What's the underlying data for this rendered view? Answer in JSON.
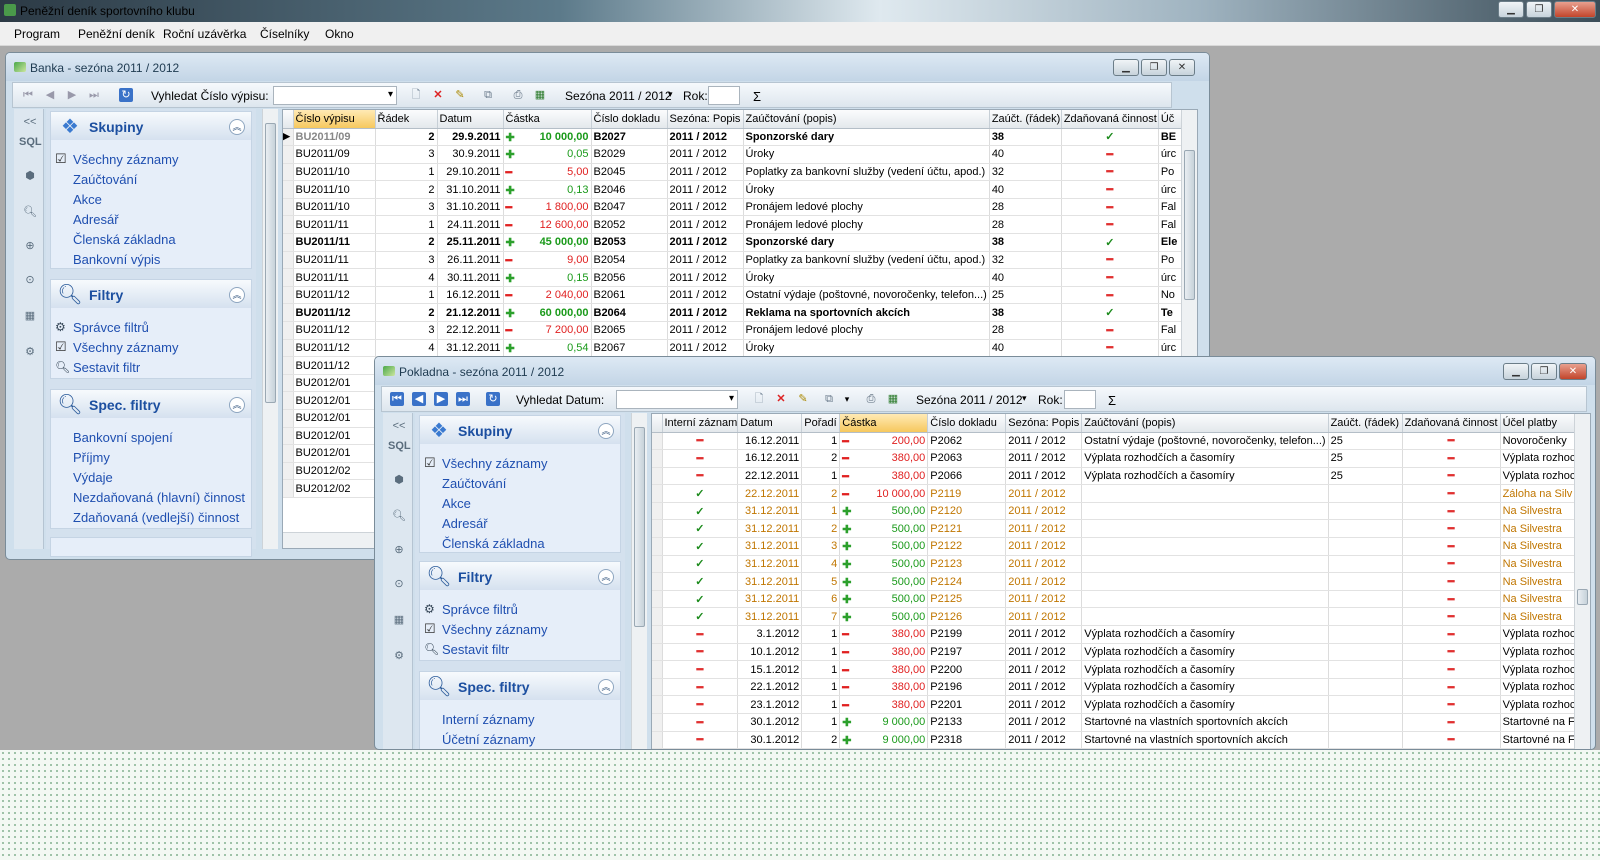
{
  "app": {
    "title": "Peněžní deník sportovního klubu",
    "menu": [
      "Program",
      "Peněžní deník",
      "Roční uzávěrka",
      "Číselníky",
      "Okno"
    ]
  },
  "banka": {
    "title": "Banka - sezóna 2011 / 2012",
    "toolbar": {
      "search_label": "Vyhledat Číslo výpisu:",
      "season": "Sezóna 2011 / 2012",
      "year_label": "Rok:",
      "sum": "Σ"
    },
    "strip": {
      "collapse": "<<",
      "sql": "SQL"
    },
    "groups": {
      "skupiny": {
        "title": "Skupiny",
        "items": [
          "Všechny záznamy",
          "Zaúčtování",
          "Akce",
          "Adresář",
          "Členská základna",
          "Bankovní výpis"
        ]
      },
      "filtry": {
        "title": "Filtry",
        "items": [
          "Správce filtrů",
          "Všechny záznamy",
          "Sestavit filtr"
        ]
      },
      "spec": {
        "title": "Spec. filtry",
        "items": [
          "Bankovní spojení",
          "Příjmy",
          "Výdaje",
          "Nezdaňovaná (hlavní) činnost",
          "Zdaňovaná (vedlejší) činnost"
        ]
      }
    },
    "columns": [
      "Číslo výpisu",
      "Řádek",
      "Datum",
      "Částka",
      "Číslo dokladu",
      "Sezóna: Popis",
      "Zaúčtování (popis)",
      "Zaúčt. (řádek)",
      "Zdaňovaná činnost",
      "Úč"
    ],
    "rows": [
      {
        "v": "BU2011/09",
        "r": "2",
        "d": "29.9.2011",
        "s": "+",
        "a": "10 000,00",
        "doc": "B2027",
        "sz": "2011 / 2012",
        "z": "Sponzorské dary",
        "zr": "38",
        "zc": "check",
        "u": "BE",
        "bold": true
      },
      {
        "v": "BU2011/09",
        "r": "3",
        "d": "30.9.2011",
        "s": "+",
        "a": "0,05",
        "doc": "B2029",
        "sz": "2011 / 2012",
        "z": "Úroky",
        "zr": "40",
        "zc": "dash",
        "u": "úrc"
      },
      {
        "v": "BU2011/10",
        "r": "1",
        "d": "29.10.2011",
        "s": "-",
        "a": "5,00",
        "doc": "B2045",
        "sz": "2011 / 2012",
        "z": "Poplatky za bankovní služby (vedení účtu, apod.)",
        "zr": "32",
        "zc": "dash",
        "u": "Po"
      },
      {
        "v": "BU2011/10",
        "r": "2",
        "d": "31.10.2011",
        "s": "+",
        "a": "0,13",
        "doc": "B2046",
        "sz": "2011 / 2012",
        "z": "Úroky",
        "zr": "40",
        "zc": "dash",
        "u": "úrc"
      },
      {
        "v": "BU2011/10",
        "r": "3",
        "d": "31.10.2011",
        "s": "-",
        "a": "1 800,00",
        "doc": "B2047",
        "sz": "2011 / 2012",
        "z": "Pronájem ledové plochy",
        "zr": "28",
        "zc": "dash",
        "u": "Fal"
      },
      {
        "v": "BU2011/11",
        "r": "1",
        "d": "24.11.2011",
        "s": "-",
        "a": "12 600,00",
        "doc": "B2052",
        "sz": "2011 / 2012",
        "z": "Pronájem ledové plochy",
        "zr": "28",
        "zc": "dash",
        "u": "Fal"
      },
      {
        "v": "BU2011/11",
        "r": "2",
        "d": "25.11.2011",
        "s": "+",
        "a": "45 000,00",
        "doc": "B2053",
        "sz": "2011 / 2012",
        "z": "Sponzorské dary",
        "zr": "38",
        "zc": "check",
        "u": "Ele",
        "bold": true
      },
      {
        "v": "BU2011/11",
        "r": "3",
        "d": "26.11.2011",
        "s": "-",
        "a": "9,00",
        "doc": "B2054",
        "sz": "2011 / 2012",
        "z": "Poplatky za bankovní služby (vedení účtu, apod.)",
        "zr": "32",
        "zc": "dash",
        "u": "Po"
      },
      {
        "v": "BU2011/11",
        "r": "4",
        "d": "30.11.2011",
        "s": "+",
        "a": "0,15",
        "doc": "B2056",
        "sz": "2011 / 2012",
        "z": "Úroky",
        "zr": "40",
        "zc": "dash",
        "u": "úrc"
      },
      {
        "v": "BU2011/12",
        "r": "1",
        "d": "16.12.2011",
        "s": "-",
        "a": "2 040,00",
        "doc": "B2061",
        "sz": "2011 / 2012",
        "z": "Ostatní výdaje (poštovné, novoročenky, telefon...)",
        "zr": "25",
        "zc": "dash",
        "u": "No"
      },
      {
        "v": "BU2011/12",
        "r": "2",
        "d": "21.12.2011",
        "s": "+",
        "a": "60 000,00",
        "doc": "B2064",
        "sz": "2011 / 2012",
        "z": "Reklama na sportovních akcích",
        "zr": "38",
        "zc": "check",
        "u": "Te",
        "bold": true
      },
      {
        "v": "BU2011/12",
        "r": "3",
        "d": "22.12.2011",
        "s": "-",
        "a": "7 200,00",
        "doc": "B2065",
        "sz": "2011 / 2012",
        "z": "Pronájem ledové plochy",
        "zr": "28",
        "zc": "dash",
        "u": "Fal"
      },
      {
        "v": "BU2011/12",
        "r": "4",
        "d": "31.12.2011",
        "s": "+",
        "a": "0,54",
        "doc": "B2067",
        "sz": "2011 / 2012",
        "z": "Úroky",
        "zr": "40",
        "zc": "dash",
        "u": "úrc"
      },
      {
        "v": "BU2011/12"
      },
      {
        "v": "BU2012/01"
      },
      {
        "v": "BU2012/01"
      },
      {
        "v": "BU2012/01"
      },
      {
        "v": "BU2012/01"
      },
      {
        "v": "BU2012/01"
      },
      {
        "v": "BU2012/02"
      },
      {
        "v": "BU2012/02"
      }
    ]
  },
  "pokladna": {
    "title": "Pokladna - sezóna 2011 / 2012",
    "toolbar": {
      "search_label": "Vyhledat Datum:",
      "season": "Sezóna 2011 / 2012",
      "year_label": "Rok:",
      "sum": "Σ"
    },
    "strip": {
      "collapse": "<<",
      "sql": "SQL"
    },
    "groups": {
      "skupiny": {
        "title": "Skupiny",
        "items": [
          "Všechny záznamy",
          "Zaúčtování",
          "Akce",
          "Adresář",
          "Členská základna"
        ]
      },
      "filtry": {
        "title": "Filtry",
        "items": [
          "Správce filtrů",
          "Všechny záznamy",
          "Sestavit filtr"
        ]
      },
      "spec": {
        "title": "Spec. filtry",
        "items": [
          "Interní záznamy",
          "Účetní záznamy"
        ]
      }
    },
    "columns": [
      "Interní záznam",
      "Datum",
      "Pořadí",
      "Částka",
      "Číslo dokladu",
      "Sezóna: Popis",
      "Zaúčtování (popis)",
      "Zaúčt. (řádek)",
      "Zdaňovaná činnost",
      "Účel platby"
    ],
    "rows": [
      {
        "i": "dash",
        "d": "16.12.2011",
        "p": "1",
        "s": "-",
        "a": "200,00",
        "doc": "P2062",
        "sz": "2011 / 2012",
        "z": "Ostatní výdaje (poštovné, novoročenky, telefon...)",
        "zr": "25",
        "zc": "dash",
        "u": "Novoročenky"
      },
      {
        "i": "dash",
        "d": "16.12.2011",
        "p": "2",
        "s": "-",
        "a": "380,00",
        "doc": "P2063",
        "sz": "2011 / 2012",
        "z": "Výplata rozhodčích a časomíry",
        "zr": "25",
        "zc": "dash",
        "u": "Výplata rozhoc"
      },
      {
        "i": "dash",
        "d": "22.12.2011",
        "p": "1",
        "s": "-",
        "a": "380,00",
        "doc": "P2066",
        "sz": "2011 / 2012",
        "z": "Výplata rozhodčích a časomíry",
        "zr": "25",
        "zc": "dash",
        "u": "Výplata rozhoc"
      },
      {
        "i": "check",
        "d": "22.12.2011",
        "p": "2",
        "s": "-",
        "a": "10 000,00",
        "doc": "P2119",
        "sz": "2011 / 2012",
        "z": "",
        "zr": "",
        "zc": "dash",
        "u": "Záloha na Silv",
        "orange": true
      },
      {
        "i": "check",
        "d": "31.12.2011",
        "p": "1",
        "s": "+",
        "a": "500,00",
        "doc": "P2120",
        "sz": "2011 / 2012",
        "z": "",
        "zr": "",
        "zc": "dash",
        "u": "Na Silvestra",
        "orange": true
      },
      {
        "i": "check",
        "d": "31.12.2011",
        "p": "2",
        "s": "+",
        "a": "500,00",
        "doc": "P2121",
        "sz": "2011 / 2012",
        "z": "",
        "zr": "",
        "zc": "dash",
        "u": "Na Silvestra",
        "orange": true
      },
      {
        "i": "check",
        "d": "31.12.2011",
        "p": "3",
        "s": "+",
        "a": "500,00",
        "doc": "P2122",
        "sz": "2011 / 2012",
        "z": "",
        "zr": "",
        "zc": "dash",
        "u": "Na Silvestra",
        "orange": true
      },
      {
        "i": "check",
        "d": "31.12.2011",
        "p": "4",
        "s": "+",
        "a": "500,00",
        "doc": "P2123",
        "sz": "2011 / 2012",
        "z": "",
        "zr": "",
        "zc": "dash",
        "u": "Na Silvestra",
        "orange": true
      },
      {
        "i": "check",
        "d": "31.12.2011",
        "p": "5",
        "s": "+",
        "a": "500,00",
        "doc": "P2124",
        "sz": "2011 / 2012",
        "z": "",
        "zr": "",
        "zc": "dash",
        "u": "Na Silvestra",
        "orange": true
      },
      {
        "i": "check",
        "d": "31.12.2011",
        "p": "6",
        "s": "+",
        "a": "500,00",
        "doc": "P2125",
        "sz": "2011 / 2012",
        "z": "",
        "zr": "",
        "zc": "dash",
        "u": "Na Silvestra",
        "orange": true
      },
      {
        "i": "check",
        "d": "31.12.2011",
        "p": "7",
        "s": "+",
        "a": "500,00",
        "doc": "P2126",
        "sz": "2011 / 2012",
        "z": "",
        "zr": "",
        "zc": "dash",
        "u": "Na Silvestra",
        "orange": true
      },
      {
        "i": "dash",
        "d": "3.1.2012",
        "p": "1",
        "s": "-",
        "a": "380,00",
        "doc": "P2199",
        "sz": "2011 / 2012",
        "z": "Výplata rozhodčích a časomíry",
        "zr": "",
        "zc": "dash",
        "u": "Výplata rozhoc"
      },
      {
        "i": "dash",
        "d": "10.1.2012",
        "p": "1",
        "s": "-",
        "a": "380,00",
        "doc": "P2197",
        "sz": "2011 / 2012",
        "z": "Výplata rozhodčích a časomíry",
        "zr": "",
        "zc": "dash",
        "u": "Výplata rozhoc"
      },
      {
        "i": "dash",
        "d": "15.1.2012",
        "p": "1",
        "s": "-",
        "a": "380,00",
        "doc": "P2200",
        "sz": "2011 / 2012",
        "z": "Výplata rozhodčích a časomíry",
        "zr": "",
        "zc": "dash",
        "u": "Výplata rozhoc"
      },
      {
        "i": "dash",
        "d": "22.1.2012",
        "p": "1",
        "s": "-",
        "a": "380,00",
        "doc": "P2196",
        "sz": "2011 / 2012",
        "z": "Výplata rozhodčích a časomíry",
        "zr": "",
        "zc": "dash",
        "u": "Výplata rozhoc"
      },
      {
        "i": "dash",
        "d": "23.1.2012",
        "p": "1",
        "s": "-",
        "a": "380,00",
        "doc": "P2201",
        "sz": "2011 / 2012",
        "z": "Výplata rozhodčích a časomíry",
        "zr": "",
        "zc": "dash",
        "u": "Výplata rozhoc"
      },
      {
        "i": "dash",
        "d": "30.1.2012",
        "p": "1",
        "s": "+",
        "a": "9 000,00",
        "doc": "P2133",
        "sz": "2011 / 2012",
        "z": "Startovné na vlastních sportovních akcích",
        "zr": "",
        "zc": "dash",
        "u": "Startovné na F"
      },
      {
        "i": "dash",
        "d": "30.1.2012",
        "p": "2",
        "s": "+",
        "a": "9 000,00",
        "doc": "P2318",
        "sz": "2011 / 2012",
        "z": "Startovné na vlastních sportovních akcích",
        "zr": "",
        "zc": "dash",
        "u": "Startovné na F"
      }
    ]
  }
}
